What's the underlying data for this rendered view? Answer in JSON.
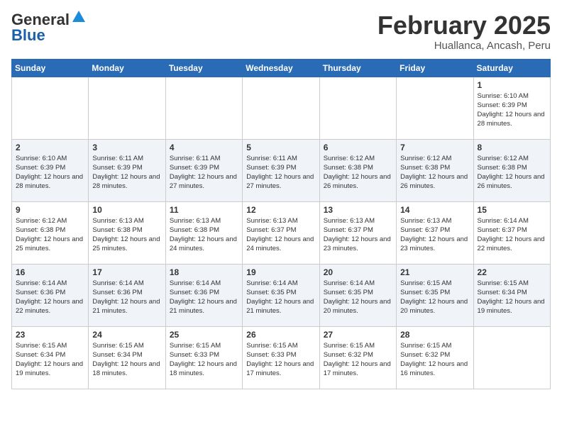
{
  "header": {
    "logo_line1": "General",
    "logo_line2": "Blue",
    "month": "February 2025",
    "location": "Huallanca, Ancash, Peru"
  },
  "weekdays": [
    "Sunday",
    "Monday",
    "Tuesday",
    "Wednesday",
    "Thursday",
    "Friday",
    "Saturday"
  ],
  "weeks": [
    [
      {
        "day": "",
        "info": ""
      },
      {
        "day": "",
        "info": ""
      },
      {
        "day": "",
        "info": ""
      },
      {
        "day": "",
        "info": ""
      },
      {
        "day": "",
        "info": ""
      },
      {
        "day": "",
        "info": ""
      },
      {
        "day": "1",
        "info": "Sunrise: 6:10 AM\nSunset: 6:39 PM\nDaylight: 12 hours and 28 minutes."
      }
    ],
    [
      {
        "day": "2",
        "info": "Sunrise: 6:10 AM\nSunset: 6:39 PM\nDaylight: 12 hours and 28 minutes."
      },
      {
        "day": "3",
        "info": "Sunrise: 6:11 AM\nSunset: 6:39 PM\nDaylight: 12 hours and 28 minutes."
      },
      {
        "day": "4",
        "info": "Sunrise: 6:11 AM\nSunset: 6:39 PM\nDaylight: 12 hours and 27 minutes."
      },
      {
        "day": "5",
        "info": "Sunrise: 6:11 AM\nSunset: 6:39 PM\nDaylight: 12 hours and 27 minutes."
      },
      {
        "day": "6",
        "info": "Sunrise: 6:12 AM\nSunset: 6:38 PM\nDaylight: 12 hours and 26 minutes."
      },
      {
        "day": "7",
        "info": "Sunrise: 6:12 AM\nSunset: 6:38 PM\nDaylight: 12 hours and 26 minutes."
      },
      {
        "day": "8",
        "info": "Sunrise: 6:12 AM\nSunset: 6:38 PM\nDaylight: 12 hours and 26 minutes."
      }
    ],
    [
      {
        "day": "9",
        "info": "Sunrise: 6:12 AM\nSunset: 6:38 PM\nDaylight: 12 hours and 25 minutes."
      },
      {
        "day": "10",
        "info": "Sunrise: 6:13 AM\nSunset: 6:38 PM\nDaylight: 12 hours and 25 minutes."
      },
      {
        "day": "11",
        "info": "Sunrise: 6:13 AM\nSunset: 6:38 PM\nDaylight: 12 hours and 24 minutes."
      },
      {
        "day": "12",
        "info": "Sunrise: 6:13 AM\nSunset: 6:37 PM\nDaylight: 12 hours and 24 minutes."
      },
      {
        "day": "13",
        "info": "Sunrise: 6:13 AM\nSunset: 6:37 PM\nDaylight: 12 hours and 23 minutes."
      },
      {
        "day": "14",
        "info": "Sunrise: 6:13 AM\nSunset: 6:37 PM\nDaylight: 12 hours and 23 minutes."
      },
      {
        "day": "15",
        "info": "Sunrise: 6:14 AM\nSunset: 6:37 PM\nDaylight: 12 hours and 22 minutes."
      }
    ],
    [
      {
        "day": "16",
        "info": "Sunrise: 6:14 AM\nSunset: 6:36 PM\nDaylight: 12 hours and 22 minutes."
      },
      {
        "day": "17",
        "info": "Sunrise: 6:14 AM\nSunset: 6:36 PM\nDaylight: 12 hours and 21 minutes."
      },
      {
        "day": "18",
        "info": "Sunrise: 6:14 AM\nSunset: 6:36 PM\nDaylight: 12 hours and 21 minutes."
      },
      {
        "day": "19",
        "info": "Sunrise: 6:14 AM\nSunset: 6:35 PM\nDaylight: 12 hours and 21 minutes."
      },
      {
        "day": "20",
        "info": "Sunrise: 6:14 AM\nSunset: 6:35 PM\nDaylight: 12 hours and 20 minutes."
      },
      {
        "day": "21",
        "info": "Sunrise: 6:15 AM\nSunset: 6:35 PM\nDaylight: 12 hours and 20 minutes."
      },
      {
        "day": "22",
        "info": "Sunrise: 6:15 AM\nSunset: 6:34 PM\nDaylight: 12 hours and 19 minutes."
      }
    ],
    [
      {
        "day": "23",
        "info": "Sunrise: 6:15 AM\nSunset: 6:34 PM\nDaylight: 12 hours and 19 minutes."
      },
      {
        "day": "24",
        "info": "Sunrise: 6:15 AM\nSunset: 6:34 PM\nDaylight: 12 hours and 18 minutes."
      },
      {
        "day": "25",
        "info": "Sunrise: 6:15 AM\nSunset: 6:33 PM\nDaylight: 12 hours and 18 minutes."
      },
      {
        "day": "26",
        "info": "Sunrise: 6:15 AM\nSunset: 6:33 PM\nDaylight: 12 hours and 17 minutes."
      },
      {
        "day": "27",
        "info": "Sunrise: 6:15 AM\nSunset: 6:32 PM\nDaylight: 12 hours and 17 minutes."
      },
      {
        "day": "28",
        "info": "Sunrise: 6:15 AM\nSunset: 6:32 PM\nDaylight: 12 hours and 16 minutes."
      },
      {
        "day": "",
        "info": ""
      }
    ]
  ]
}
